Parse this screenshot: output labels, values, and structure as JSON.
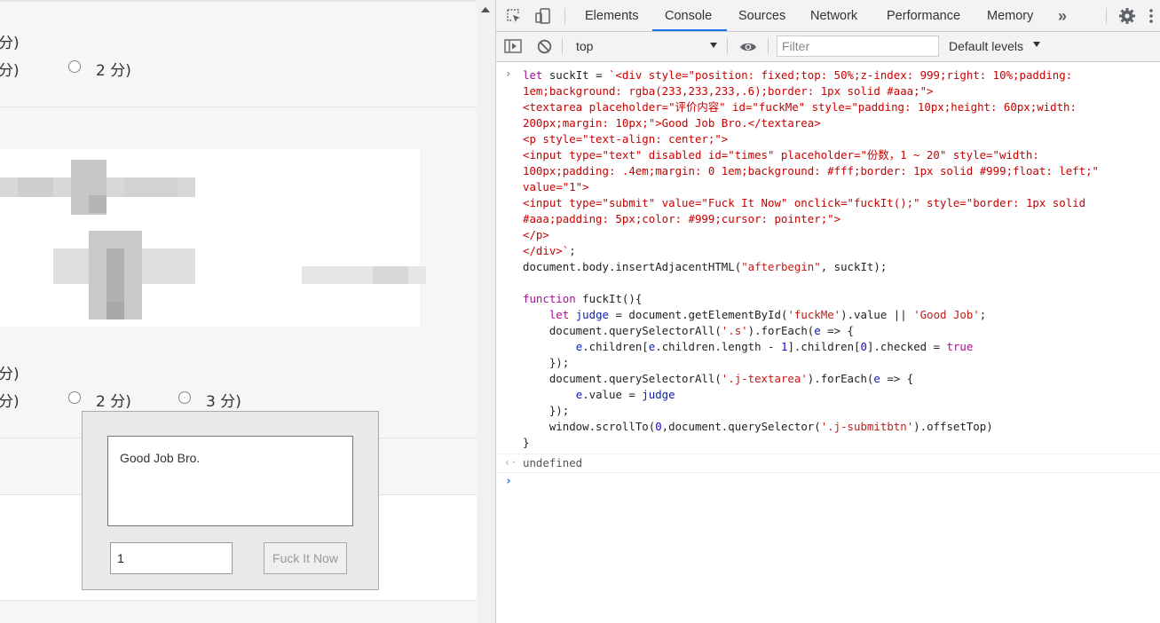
{
  "page": {
    "row1_label": "分)",
    "row2_opt1": "分)",
    "row2_opt2": "2 分)",
    "row3_label": "分)",
    "row4_opt1": "分)",
    "row4_opt2": "2 分)",
    "row4_opt3": "3 分)"
  },
  "overlay": {
    "textarea_value": "Good Job Bro.",
    "times_value": "1",
    "submit_label": "Fuck It Now"
  },
  "devtools": {
    "tabs": [
      "Elements",
      "Console",
      "Sources",
      "Network",
      "Performance",
      "Memory"
    ],
    "active_tab": "Console",
    "more_tabs": "»",
    "context": "top",
    "filter_placeholder": "Filter",
    "levels": "Default levels",
    "console": {
      "result": "undefined"
    }
  },
  "colors": {
    "accent": "#1a73e8",
    "string_red": "#c80000",
    "keyword": "#aa0d91"
  }
}
